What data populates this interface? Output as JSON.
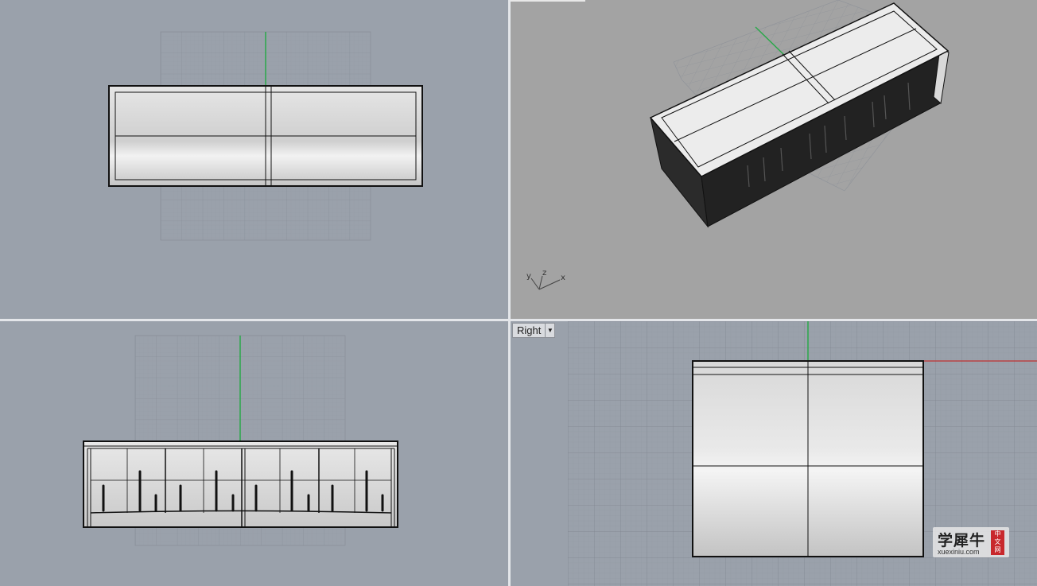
{
  "viewports": {
    "top": {
      "label": ""
    },
    "perspective": {
      "label": "",
      "axes": {
        "y": "y",
        "z": "z",
        "x": "x"
      }
    },
    "front": {
      "label": ""
    },
    "right": {
      "label": "Right",
      "dropdown_icon": "caret-down-icon"
    }
  },
  "watermark": {
    "brand": "学犀牛",
    "url": "xuexiniu.com",
    "seal_line1": "中",
    "seal_line2": "文",
    "seal_line3": "网"
  },
  "colors": {
    "viewport_bg": "#9aa1ab",
    "perspective_bg": "#a3a3a3",
    "y_axis": "#2aa84a",
    "x_axis": "#c03030",
    "grid": "#8a919b"
  }
}
